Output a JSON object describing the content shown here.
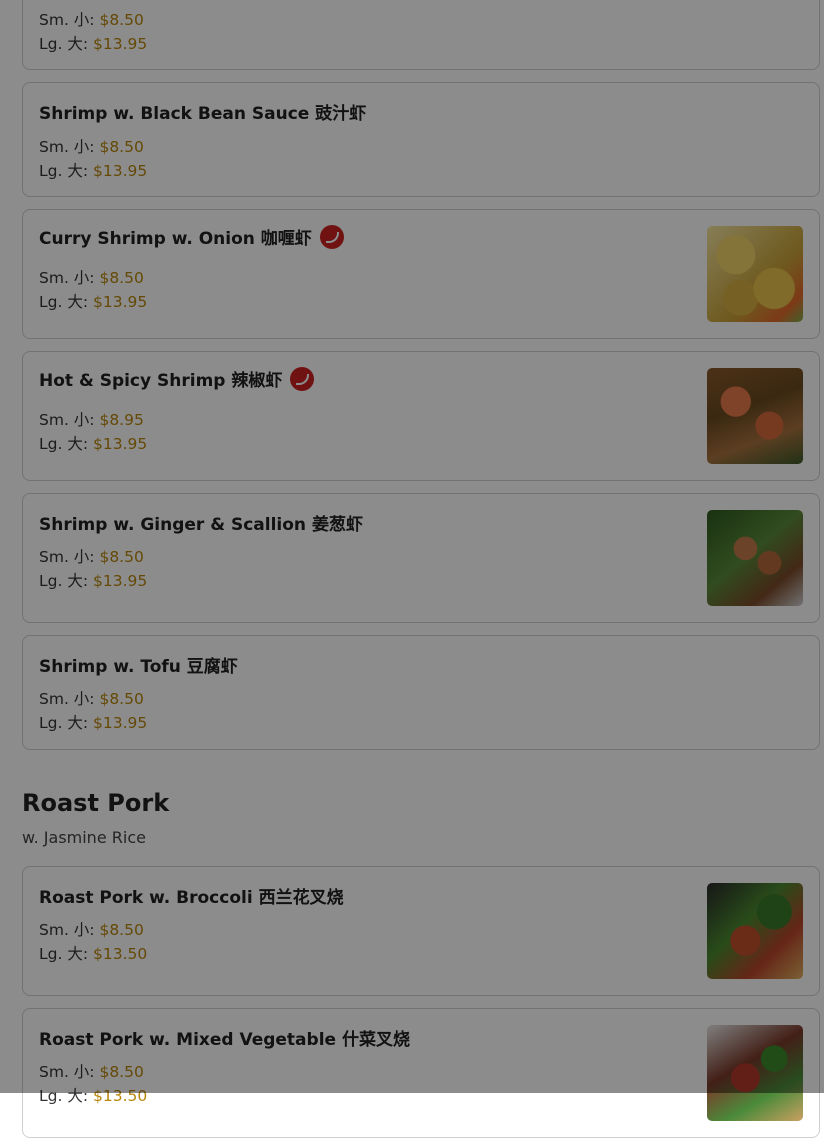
{
  "items": [
    {
      "name": "",
      "sm_label": "Sm. 小:",
      "sm_price": "$8.50",
      "lg_label": "Lg. 大:",
      "lg_price": "$13.95"
    },
    {
      "name": "Shrimp w. Black Bean Sauce 豉汁虾",
      "sm_label": "Sm. 小:",
      "sm_price": "$8.50",
      "lg_label": "Lg. 大:",
      "lg_price": "$13.95"
    },
    {
      "name": "Curry Shrimp w. Onion 咖喱虾",
      "spicy": true,
      "sm_label": "Sm. 小:",
      "sm_price": "$8.50",
      "lg_label": "Lg. 大:",
      "lg_price": "$13.95",
      "image": "curry-shrimp-photo"
    },
    {
      "name": "Hot & Spicy Shrimp 辣椒虾",
      "spicy": true,
      "sm_label": "Sm. 小:",
      "sm_price": "$8.95",
      "lg_label": "Lg. 大:",
      "lg_price": "$13.95",
      "image": "hot-spicy-shrimp-photo"
    },
    {
      "name": "Shrimp w. Ginger & Scallion 姜葱虾",
      "sm_label": "Sm. 小:",
      "sm_price": "$8.50",
      "lg_label": "Lg. 大:",
      "lg_price": "$13.95",
      "image": "ginger-scallion-shrimp-photo"
    },
    {
      "name": "Shrimp w. Tofu 豆腐虾",
      "sm_label": "Sm. 小:",
      "sm_price": "$8.50",
      "lg_label": "Lg. 大:",
      "lg_price": "$13.95"
    }
  ],
  "section": {
    "title": "Roast Pork",
    "subtitle": "w. Jasmine Rice"
  },
  "pork_items": [
    {
      "name": "Roast Pork w. Broccoli 西兰花叉烧",
      "sm_label": "Sm. 小:",
      "sm_price": "$8.50",
      "lg_label": "Lg. 大:",
      "lg_price": "$13.50",
      "image": "roast-pork-broccoli-photo"
    },
    {
      "name": "Roast Pork w. Mixed Vegetable 什菜叉烧",
      "sm_label": "Sm. 小:",
      "sm_price": "$8.50",
      "lg_label": "Lg. 大:",
      "lg_price": "$13.50",
      "image": "roast-pork-mixed-vegetable-photo"
    }
  ],
  "colors": {
    "price": "#b8860b",
    "spicy_badge": "#cc2222",
    "overlay": "rgba(0,0,0,0.45)"
  }
}
